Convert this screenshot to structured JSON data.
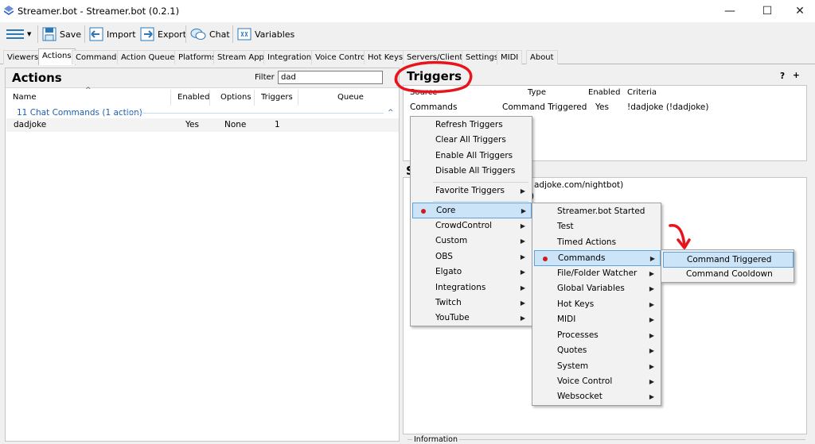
{
  "window": {
    "title": "Streamer.bot - Streamer.bot (0.2.1)",
    "minimize": "—",
    "maximize": "☐",
    "close": "✕"
  },
  "toolbar": {
    "save": "Save",
    "import": "Import",
    "export": "Export",
    "chat": "Chat",
    "variables": "Variables"
  },
  "tabs": [
    "Viewers",
    "Actions",
    "Commands",
    "Action Queues",
    "Platforms",
    "Stream Apps",
    "Integrations",
    "Voice Control",
    "Hot Keys",
    "Servers/Clients",
    "Settings",
    "MIDI",
    "About"
  ],
  "actions": {
    "title": "Actions",
    "filter_label": "Filter",
    "filter_value": "dad",
    "columns": [
      "Name",
      "Enabled",
      "Options",
      "Triggers",
      "Queue"
    ],
    "group": "11 Chat Commands (1 action)",
    "rows": [
      {
        "name": "dadjoke",
        "enabled": "Yes",
        "options": "None",
        "triggers": "1",
        "queue": ""
      }
    ]
  },
  "triggers": {
    "title": "Triggers",
    "help": "?",
    "add": "+",
    "columns": [
      "Source",
      "Type",
      "Enabled",
      "Criteria"
    ],
    "rows": [
      {
        "source": "Commands",
        "type": "Command Triggered",
        "enabled": "Yes",
        "criteria": "!dadjoke (!dadjoke)"
      }
    ]
  },
  "subactions": {
    "title": "S",
    "line1": "adjoke.com/nightbot)",
    "line2": ")"
  },
  "information": "Information",
  "context_menu": {
    "items": [
      "Refresh Triggers",
      "Clear All Triggers",
      "Enable All Triggers",
      "Disable All Triggers",
      "Favorite Triggers",
      "Core",
      "CrowdControl",
      "Custom",
      "OBS",
      "Elgato",
      "Integrations",
      "Twitch",
      "YouTube"
    ]
  },
  "core_menu": {
    "items": [
      "Streamer.bot Started",
      "Test",
      "Timed Actions",
      "Commands",
      "File/Folder Watcher",
      "Global Variables",
      "Hot Keys",
      "MIDI",
      "Processes",
      "Quotes",
      "System",
      "Voice Control",
      "Websocket"
    ]
  },
  "commands_menu": {
    "items": [
      "Command Triggered",
      "Command Cooldown"
    ]
  },
  "colors": {
    "highlight": "#cce4f7",
    "highlight_border": "#5ba3e0",
    "annotation_red": "#e8141c",
    "group_blue": "#1a5fb4"
  }
}
